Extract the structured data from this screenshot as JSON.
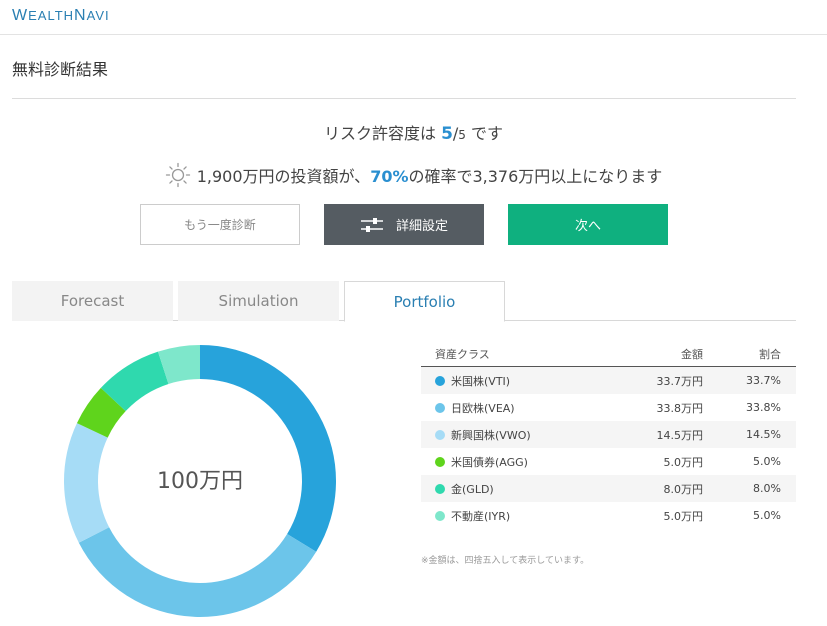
{
  "header": {
    "logo_first": "W",
    "logo_rest1": "EALTH",
    "logo_n": "N",
    "logo_rest2": "AVI"
  },
  "page": {
    "title": "無料診断結果"
  },
  "risk": {
    "prefix": "リスク許容度は ",
    "value": "5",
    "slash": "/",
    "max": "5",
    "suffix": " です"
  },
  "forecast": {
    "prefix": "1,900万円の投資額が、",
    "probability": "70%",
    "suffix": "の確率で3,376万円以上になります"
  },
  "buttons": {
    "retry": "もう一度診断",
    "detail": "詳細設定",
    "next": "次へ"
  },
  "tabs": [
    {
      "label": "Forecast",
      "active": false
    },
    {
      "label": "Simulation",
      "active": false
    },
    {
      "label": "Portfolio",
      "active": true
    }
  ],
  "portfolio": {
    "total_label": "100万円",
    "headers": {
      "asset": "資産クラス",
      "amount": "金額",
      "ratio": "割合"
    },
    "rows": [
      {
        "name": "米国株(VTI)",
        "amount": "33.7万円",
        "ratio": "33.7%",
        "value": 33.7,
        "color": "#27a3db"
      },
      {
        "name": "日欧株(VEA)",
        "amount": "33.8万円",
        "ratio": "33.8%",
        "value": 33.8,
        "color": "#6cc5ea"
      },
      {
        "name": "新興国株(VWO)",
        "amount": "14.5万円",
        "ratio": "14.5%",
        "value": 14.5,
        "color": "#a6dcf6"
      },
      {
        "name": "米国債券(AGG)",
        "amount": "5.0万円",
        "ratio": "5.0%",
        "value": 5.0,
        "color": "#5fd41c"
      },
      {
        "name": "金(GLD)",
        "amount": "8.0万円",
        "ratio": "8.0%",
        "value": 8.0,
        "color": "#2fd9ae"
      },
      {
        "name": "不動産(IYR)",
        "amount": "5.0万円",
        "ratio": "5.0%",
        "value": 5.0,
        "color": "#7ee7cb"
      }
    ],
    "note": "※金額は、四捨五入して表示しています。"
  },
  "colors": {
    "accent_blue": "#2a8fd0",
    "next_green": "#0fb07f",
    "detail_gray": "#555c62"
  },
  "icons": {
    "sun": "sun-icon",
    "sliders": "sliders-icon"
  }
}
